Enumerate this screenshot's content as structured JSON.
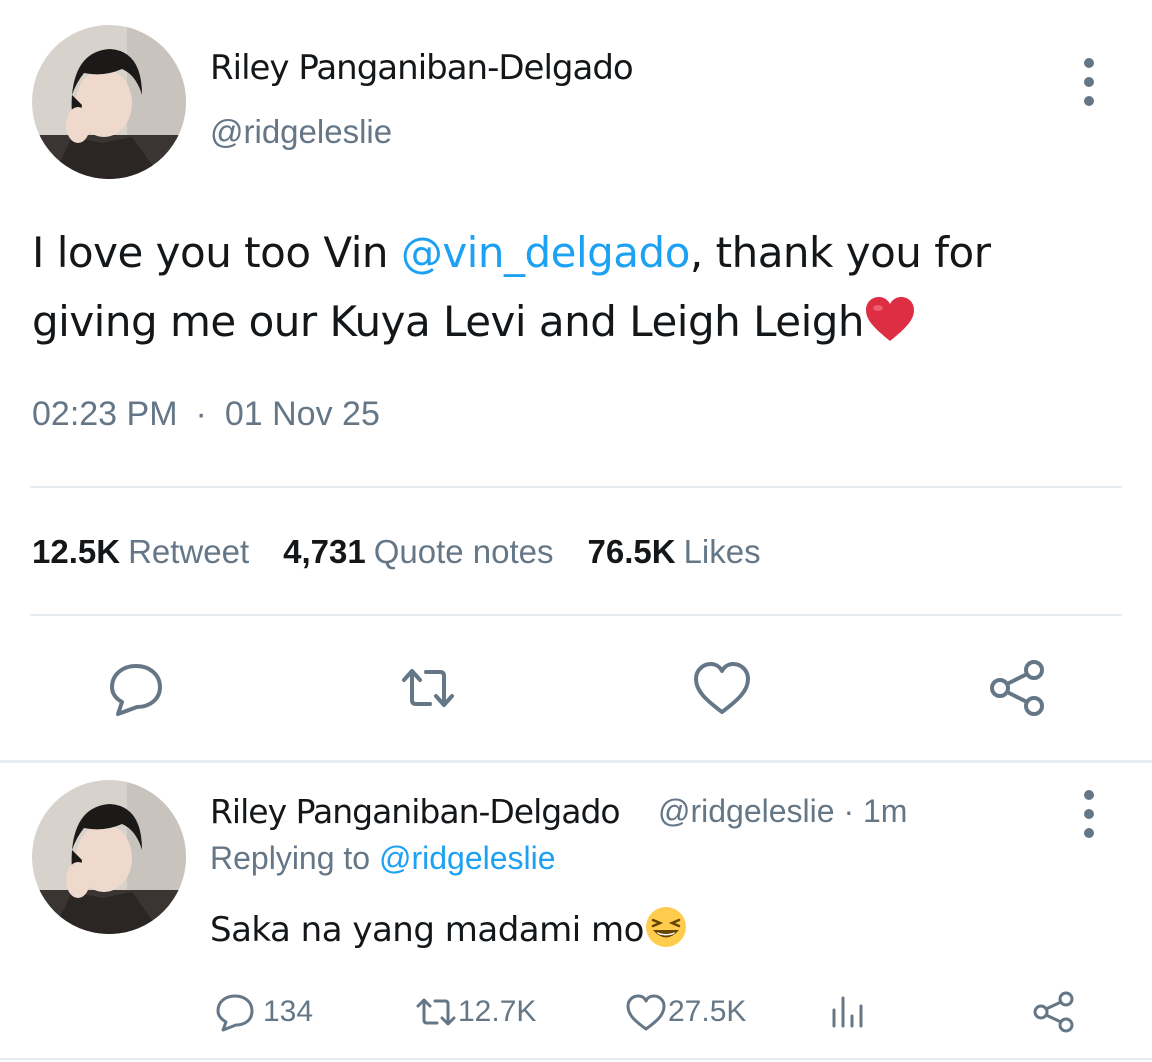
{
  "tweet": {
    "author_name": "Riley Panganiban-Delgado",
    "author_handle": "@ridgeleslie",
    "text_before": "I love you too Vin ",
    "mention": "@vin_delgado",
    "text_after": ", thank you for giving me our Kuya Levi and Leigh Leigh",
    "emoji": "red-heart",
    "time": "02:23 PM",
    "separator": "·",
    "date": "01 Nov 25",
    "stats": [
      {
        "count": "12.5K",
        "label": "Retweet"
      },
      {
        "count": "4,731",
        "label": "Quote notes"
      },
      {
        "count": "76.5K",
        "label": "Likes"
      }
    ],
    "actions": [
      "reply-icon",
      "retweet-icon",
      "like-icon",
      "share-icon"
    ]
  },
  "reply": {
    "author_name": "Riley Panganiban-Delgado",
    "author_handle": "@ridgeleslie",
    "time_ago": "· 1m",
    "replying_to_label": "Replying to",
    "replying_to_handle": "@ridgeleslie",
    "text": "Saka na yang madami mo",
    "emoji": "laughing-face",
    "reply_count": "134",
    "retweet_count": "12.7K",
    "like_count": "27.5K"
  },
  "colors": {
    "accent": "#1da1f2",
    "text": "#14171a",
    "muted": "#657786",
    "divider": "#e6ecf0",
    "heart": "#e0245e"
  }
}
